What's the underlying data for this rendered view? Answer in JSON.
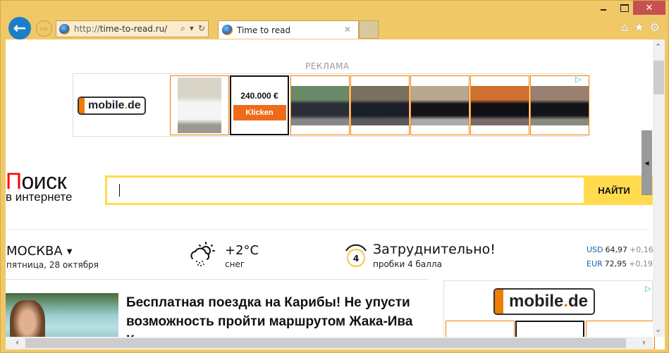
{
  "window": {
    "controls": {
      "minimize": "minimize",
      "maximize": "maximize",
      "close": "✕"
    }
  },
  "navbar": {
    "back_icon": "←",
    "forward_icon": "⇨",
    "address": {
      "protocol": "http://",
      "host": "time-to-read.ru/"
    },
    "address_tools": {
      "search": "⌕",
      "dropdown": "▾",
      "refresh": "↻"
    },
    "tab": {
      "title": "Time to read",
      "close": "✕"
    },
    "tool_icons": {
      "home": "⌂",
      "favorites": "★",
      "settings": "⚙"
    }
  },
  "ad_banner": {
    "label": "РЕКЛАМА",
    "brand": {
      "name": "mobile",
      "dot": ".",
      "tld": "de"
    },
    "price": "240.000 €",
    "cta": "Klicken",
    "adchoices_icon": "▷",
    "tiles": [
      {
        "name": "white-supercar-garage",
        "colors": [
          "#d8d4c8",
          "#f4f4f4",
          "#9a9a90"
        ]
      },
      {
        "name": "dark-suv-rear",
        "colors": [
          "#6a8a6a",
          "#2a2e38",
          "#888"
        ]
      },
      {
        "name": "black-sedan-street",
        "colors": [
          "#7a7060",
          "#1a1e28",
          "#5a5a5a"
        ]
      },
      {
        "name": "black-supercar-house",
        "colors": [
          "#b8a890",
          "#141418",
          "#aaa"
        ]
      },
      {
        "name": "black-suv-dealership",
        "colors": [
          "#d07030",
          "#101014",
          "#7a6a6a"
        ]
      },
      {
        "name": "black-suv-garages",
        "colors": [
          "#9a8070",
          "#121418",
          "#8a8a80"
        ]
      }
    ]
  },
  "search": {
    "logo_first_letter": "П",
    "logo_rest": "оиск",
    "logo_sub": "в интернете",
    "input_value": "",
    "button": "НАЙТИ"
  },
  "info": {
    "city": "МОСКВА",
    "date": "пятница, 28 октября",
    "temperature": "+2°C",
    "condition": "снег",
    "traffic_level": "4",
    "traffic_title": "Затруднительно!",
    "traffic_sub": "пробки 4 балла",
    "rates": [
      {
        "code": "USD",
        "value": "64,97",
        "change": "+0,16"
      },
      {
        "code": "EUR",
        "value": "72,95",
        "change": "+0,19"
      }
    ]
  },
  "news": {
    "title": "Бесплатная поездка на Карибы! Не упусти возможность пройти маршрутом Жака-Ива Кусто"
  },
  "side_ad": {
    "brand": {
      "name": "mobile",
      "dot": ".",
      "tld": "de"
    },
    "adchoices_icon": "▷"
  },
  "scrollbars": {
    "up": "⌃",
    "down": "⌄",
    "left": "‹",
    "right": "›",
    "side_tab": "◀"
  }
}
